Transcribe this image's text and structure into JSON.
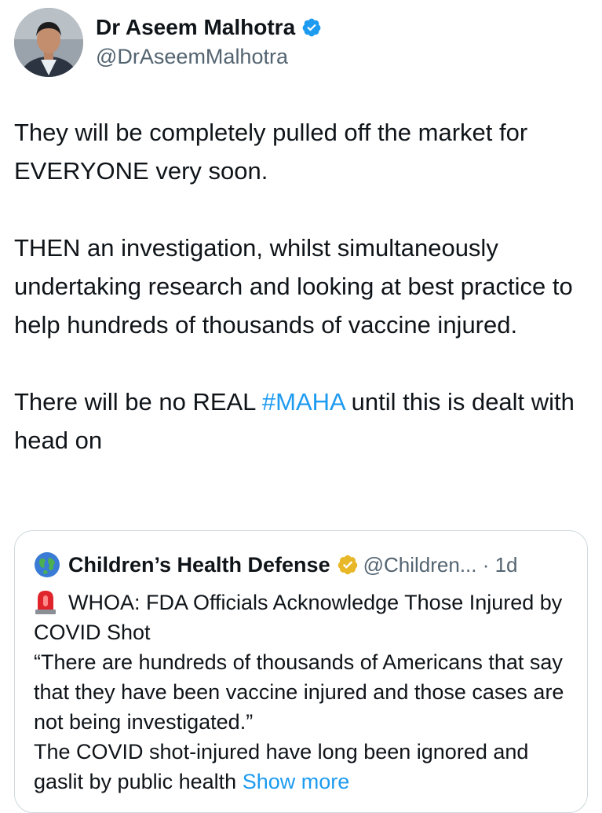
{
  "tweet": {
    "author_name": "Dr Aseem Malhotra",
    "author_handle": "@DrAseemMalhotra",
    "paragraph1": "They will be completely pulled off the market for EVERYONE very soon.",
    "paragraph2": "THEN an investigation, whilst simultaneously undertaking research and looking at best practice to help hundreds of thousands of vaccine injured.",
    "paragraph3_before": "There will be no REAL ",
    "hashtag": "#MAHA",
    "paragraph3_after": " until this is dealt with head on"
  },
  "quoted_tweet": {
    "author_name": "Children’s Health Defense",
    "author_handle_time": "@Children... · 1d",
    "headline": "WHOA: FDA Officials Acknowledge Those Injured by COVID Shot",
    "quote": "“There are hundreds of thousands of Americans that say that they have been vaccine injured and those cases are not being investigated.”",
    "body": "The COVID shot-injured have long been ignored and gaslit by public health",
    "show_more": "Show more"
  },
  "colors": {
    "verified_blue": "#1d9bf0",
    "gold_badge": "#e8b829",
    "hashtag": "#1d9bf0",
    "secondary_text": "#536471"
  },
  "icons": {
    "verified": "verified-badge-icon",
    "globe": "globe-icon",
    "gold_badge": "gold-verified-badge-icon",
    "siren": "siren-emoji-icon"
  }
}
